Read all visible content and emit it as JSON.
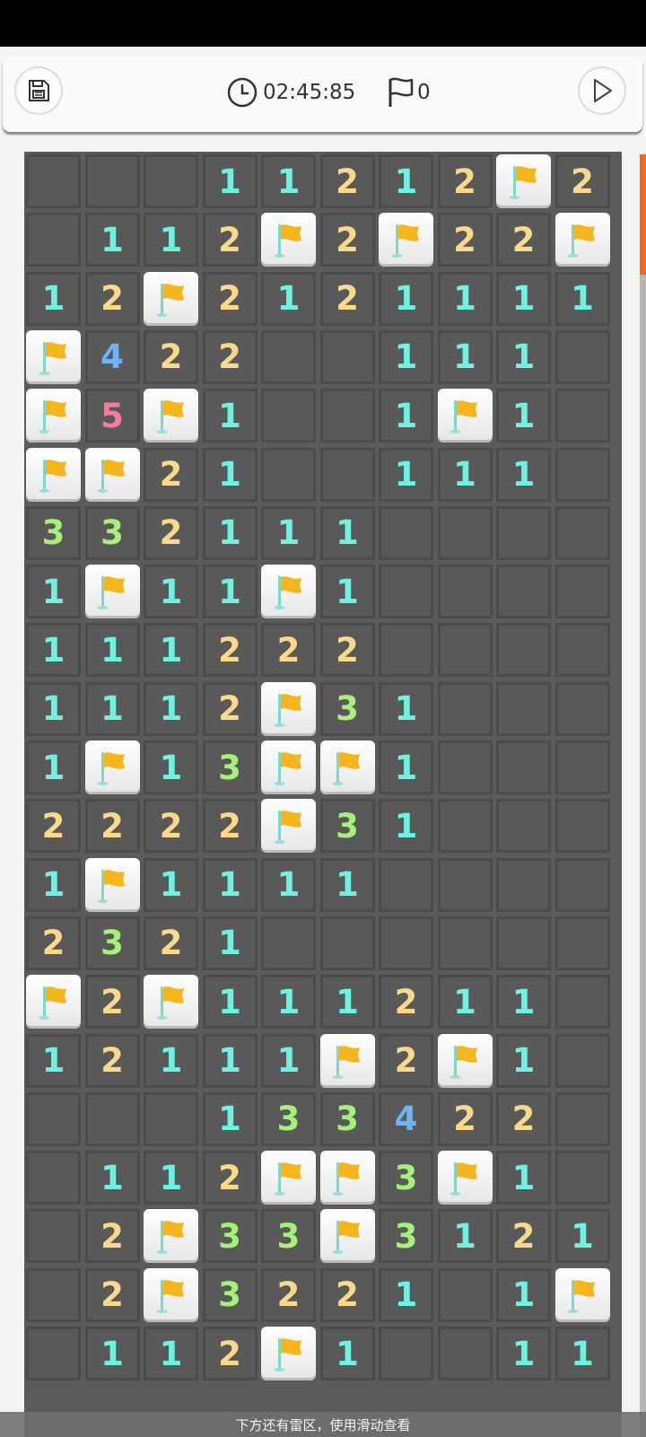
{
  "header": {
    "timer": "02:45:85",
    "flag_count": "0",
    "save_icon": "save-disk-icon",
    "clock_icon": "clock-icon",
    "flag_icon": "flag-outline-icon",
    "play_icon": "play-icon"
  },
  "board": {
    "columns": 10,
    "legend": "F = flagged cell, number = revealed count, empty = revealed blank",
    "rows": [
      [
        "",
        "",
        "",
        "1",
        "1",
        "2",
        "1",
        "2",
        "F",
        "2"
      ],
      [
        "",
        "1",
        "1",
        "2",
        "F",
        "2",
        "F",
        "2",
        "2",
        "F"
      ],
      [
        "1",
        "2",
        "F",
        "2",
        "1",
        "2",
        "1",
        "1",
        "1",
        "1"
      ],
      [
        "F",
        "4",
        "2",
        "2",
        "",
        "",
        "1",
        "1",
        "1",
        ""
      ],
      [
        "F",
        "5",
        "F",
        "1",
        "",
        "",
        "1",
        "F",
        "1",
        ""
      ],
      [
        "F",
        "F",
        "2",
        "1",
        "",
        "",
        "1",
        "1",
        "1",
        ""
      ],
      [
        "3",
        "3",
        "2",
        "1",
        "1",
        "1",
        "",
        "",
        "",
        ""
      ],
      [
        "1",
        "F",
        "1",
        "1",
        "F",
        "1",
        "",
        "",
        "",
        ""
      ],
      [
        "1",
        "1",
        "1",
        "2",
        "2",
        "2",
        "",
        "",
        "",
        ""
      ],
      [
        "1",
        "1",
        "1",
        "2",
        "F",
        "3",
        "1",
        "",
        "",
        ""
      ],
      [
        "1",
        "F",
        "1",
        "3",
        "F",
        "F",
        "1",
        "",
        "",
        ""
      ],
      [
        "2",
        "2",
        "2",
        "2",
        "F",
        "3",
        "1",
        "",
        "",
        ""
      ],
      [
        "1",
        "F",
        "1",
        "1",
        "1",
        "1",
        "",
        "",
        "",
        ""
      ],
      [
        "2",
        "3",
        "2",
        "1",
        "",
        "",
        "",
        "",
        "",
        ""
      ],
      [
        "F",
        "2",
        "F",
        "1",
        "1",
        "1",
        "2",
        "1",
        "1",
        ""
      ],
      [
        "1",
        "2",
        "1",
        "1",
        "1",
        "F",
        "2",
        "F",
        "1",
        ""
      ],
      [
        "",
        "",
        "",
        "1",
        "3",
        "3",
        "4",
        "2",
        "2",
        ""
      ],
      [
        "",
        "1",
        "1",
        "2",
        "F",
        "F",
        "3",
        "F",
        "1",
        ""
      ],
      [
        "",
        "2",
        "F",
        "3",
        "3",
        "F",
        "3",
        "1",
        "2",
        "1"
      ],
      [
        "",
        "2",
        "F",
        "3",
        "2",
        "2",
        "1",
        "",
        "1",
        "F"
      ],
      [
        "",
        "1",
        "1",
        "2",
        "F",
        "1",
        "",
        "",
        "1",
        "1"
      ]
    ],
    "number_colors": {
      "1": "#6ef3e3",
      "2": "#fbd98a",
      "3": "#a6f17a",
      "4": "#6cb4f5",
      "5": "#f47ca0"
    },
    "flag_color": "#f5b51d"
  },
  "footer": {
    "hint": "下方还有雷区，使用滑动查看"
  },
  "colors": {
    "accent": "#f26722",
    "board_bg": "#5b5b5b",
    "cell_bg": "#595959"
  }
}
